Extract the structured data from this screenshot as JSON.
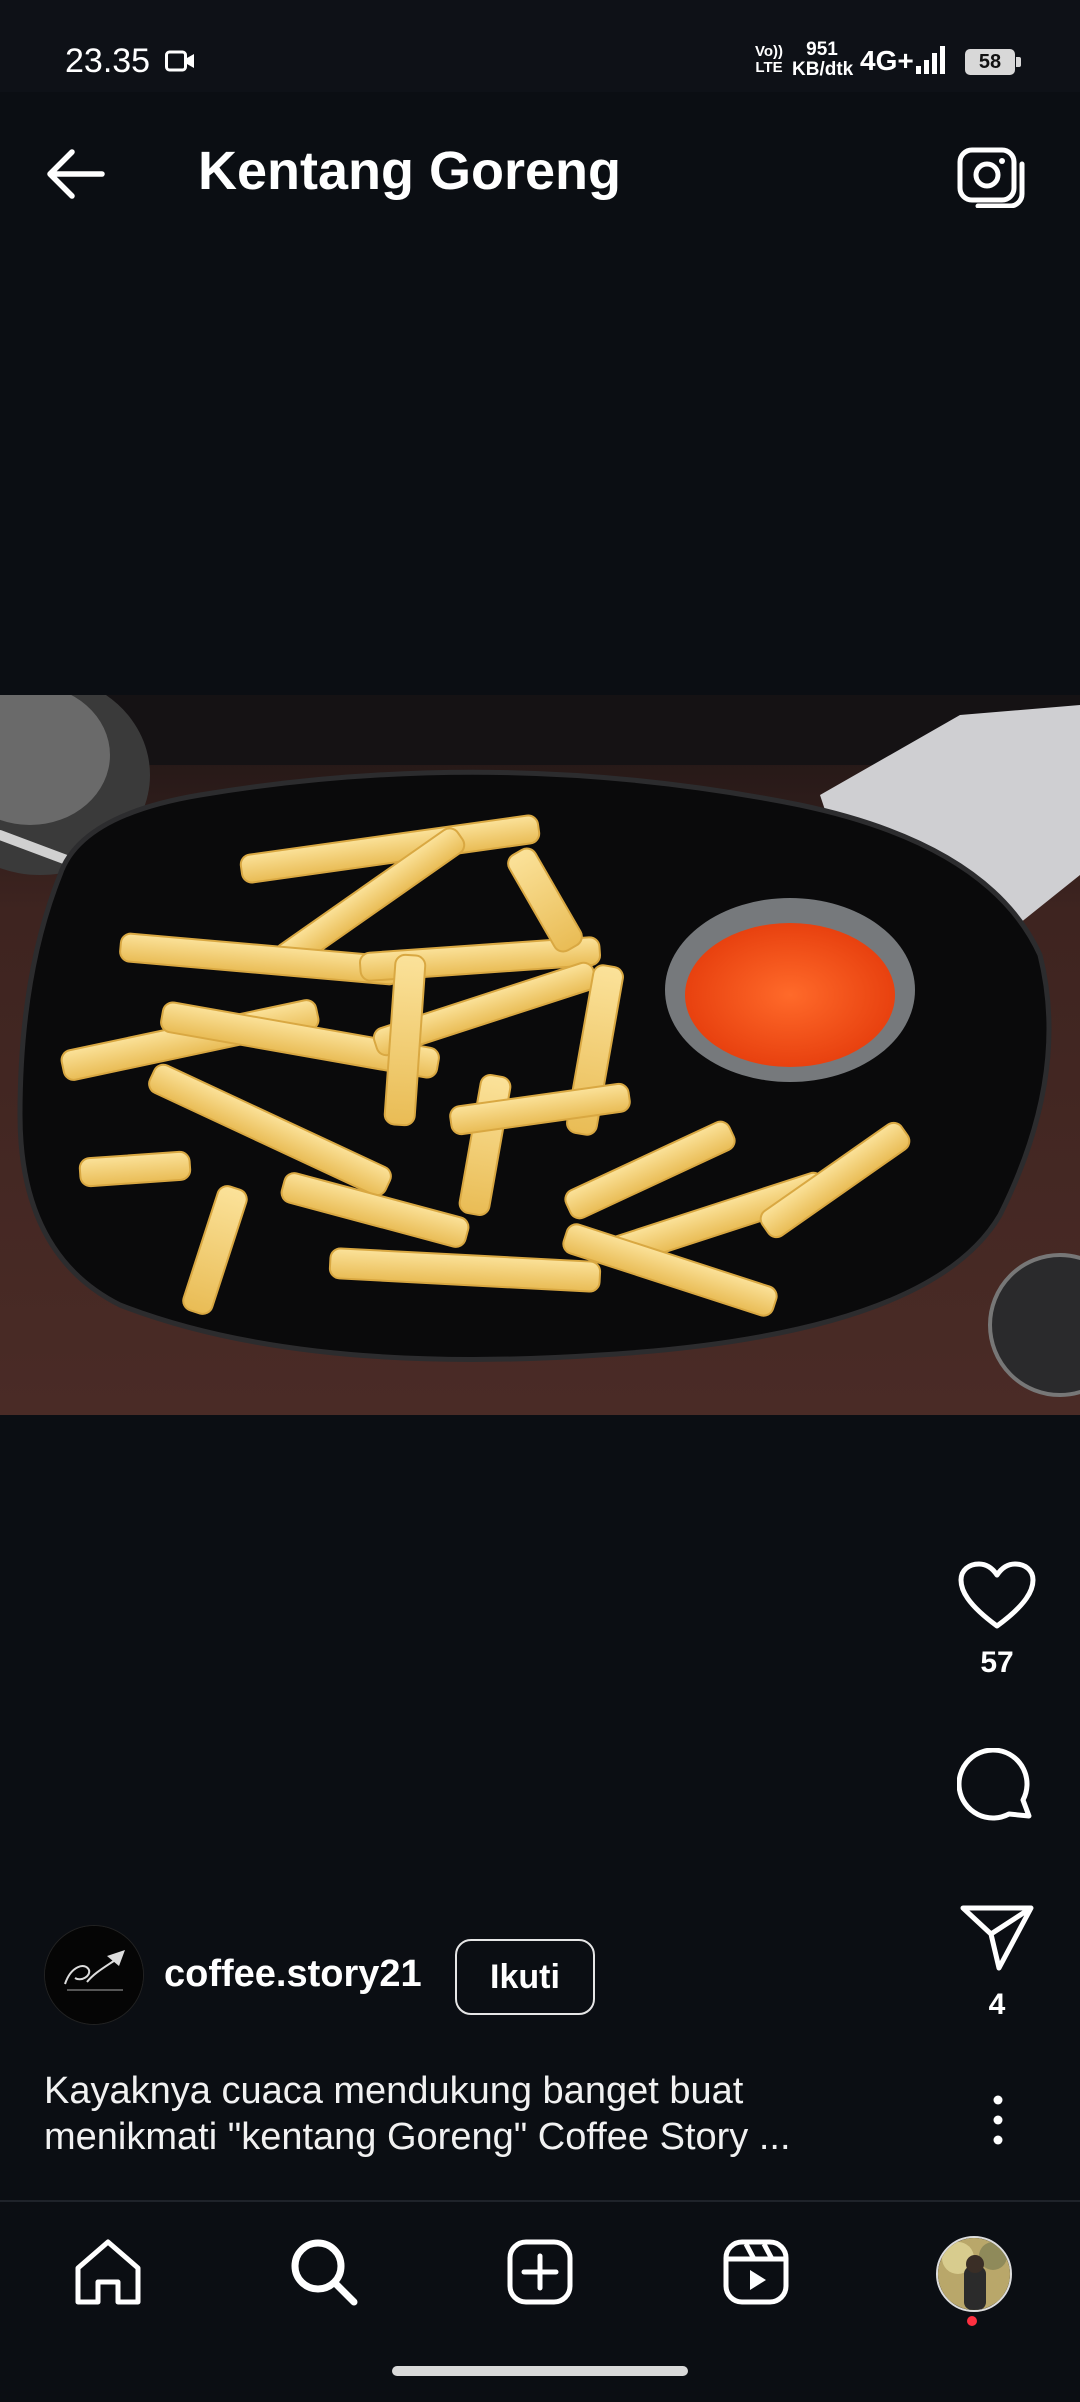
{
  "status_bar": {
    "time": "23.35",
    "volte_top": "Vo))",
    "volte_bottom": "LTE",
    "speed_value": "951",
    "speed_unit": "KB/dtk",
    "network": "4G+",
    "battery": "58"
  },
  "header": {
    "title": "Kentang Goreng",
    "back_icon": "arrow-left-icon",
    "camera_icon": "camera-icon"
  },
  "post": {
    "image_subject": "french fries with chili sauce on a black plate",
    "like_icon": "heart-icon",
    "like_count": "57",
    "comment_icon": "comment-icon",
    "share_icon": "share-icon",
    "share_count": "4",
    "more_icon": "more-vertical-icon",
    "author": {
      "username": "coffee.story21",
      "follow_label": "Ikuti"
    },
    "caption_line1": "Kayaknya cuaca mendukung banget buat",
    "caption_line2": "menikmati \"kentang Goreng\" Coffee Story ..."
  },
  "nav": {
    "items": [
      "home-icon",
      "search-icon",
      "create-icon",
      "reels-icon",
      "profile-avatar"
    ]
  },
  "colors": {
    "background": "#0b0e13",
    "notification_dot": "#ff3040"
  }
}
